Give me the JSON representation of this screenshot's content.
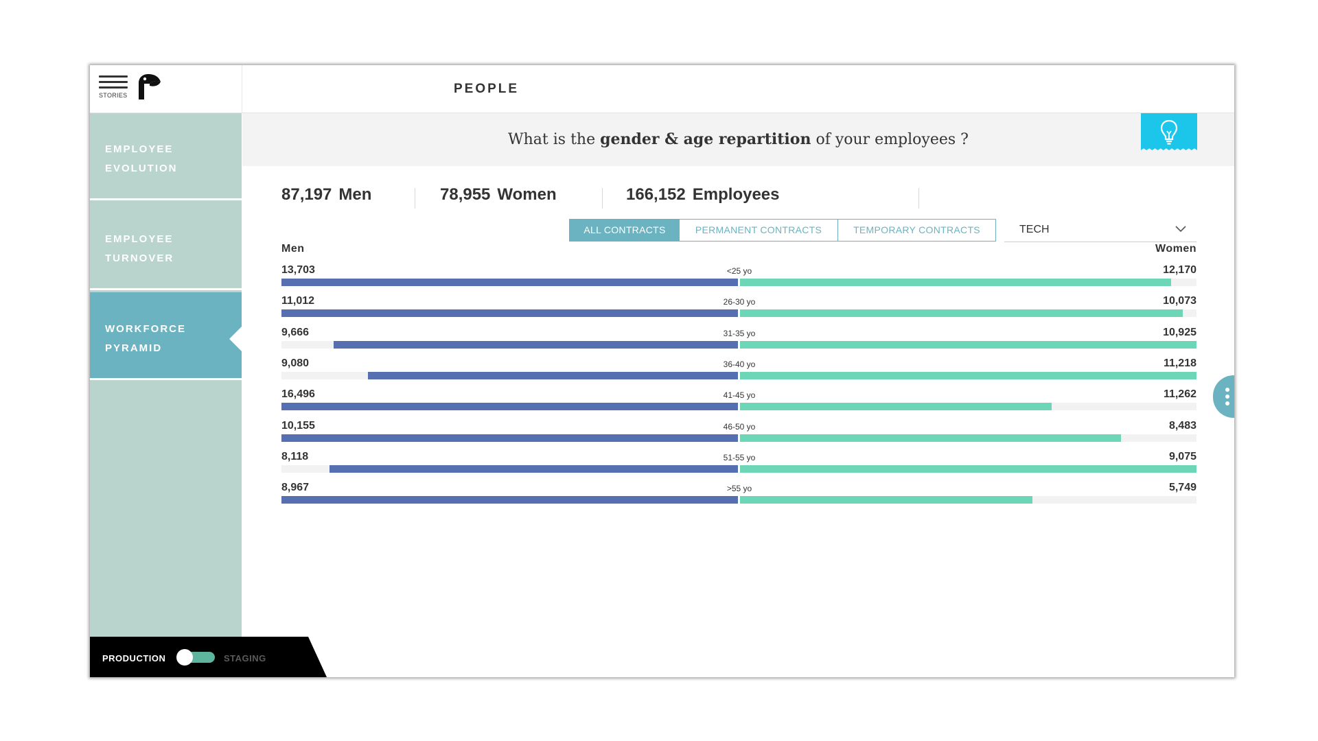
{
  "header": {
    "menu_label": "STORIES",
    "title": "PEOPLE"
  },
  "sidebar": {
    "items": [
      {
        "line1": "EMPLOYEE",
        "line2": "EVOLUTION",
        "active": false
      },
      {
        "line1": "EMPLOYEE",
        "line2": "TURNOVER",
        "active": false
      },
      {
        "line1": "WORKFORCE",
        "line2": "PYRAMID",
        "active": true
      }
    ]
  },
  "environment": {
    "production_label": "PRODUCTION",
    "staging_label": "STAGING",
    "current": "production"
  },
  "question": {
    "pre": "What is the ",
    "bold": "gender & age repartition",
    "post": " of your employees ?"
  },
  "stats": {
    "men": {
      "value": "87,197",
      "label": "Men"
    },
    "women": {
      "value": "78,955",
      "label": "Women"
    },
    "employees": {
      "value": "166,152",
      "label": "Employees"
    }
  },
  "filters": {
    "contracts": [
      {
        "label": "ALL CONTRACTS",
        "active": true
      },
      {
        "label": "PERMANENT CONTRACTS",
        "active": false
      },
      {
        "label": "TEMPORARY CONTRACTS",
        "active": false
      }
    ],
    "department": "TECH"
  },
  "colors": {
    "men": "#556fb0",
    "women": "#6dd6b7",
    "accent": "#6bb3c0",
    "sidebar": "#b8d4cd",
    "tip": "#1cc6ea"
  },
  "icons": {
    "menu": "hamburger-icon",
    "logo": "toucan-logo-icon",
    "tip": "lightbulb-icon",
    "dropdown": "chevron-down-icon",
    "more": "vertical-dots-icon"
  },
  "chart_data": {
    "type": "bar",
    "orientation": "horizontal-diverging",
    "left_label": "Men",
    "right_label": "Women",
    "categories": [
      "<25 yo",
      "26-30 yo",
      "31-35 yo",
      "36-40 yo",
      "41-45 yo",
      "46-50 yo",
      "51-55 yo",
      ">55 yo"
    ],
    "series": [
      {
        "name": "Men",
        "values": [
          13703,
          11012,
          9666,
          9080,
          16496,
          10155,
          8118,
          8967
        ],
        "labels": [
          "13,703",
          "11,012",
          "9,666",
          "9,080",
          "16,496",
          "10,155",
          "8,118",
          "8,967"
        ]
      },
      {
        "name": "Women",
        "values": [
          12170,
          10073,
          10925,
          11218,
          11262,
          8483,
          9075,
          5749
        ],
        "labels": [
          "12,170",
          "10,073",
          "10,925",
          "11,218",
          "11,262",
          "8,483",
          "9,075",
          "5,749"
        ]
      }
    ],
    "bar_fill_fraction": {
      "Men": [
        1.0,
        1.0,
        0.885,
        0.81,
        1.0,
        1.0,
        0.895,
        1.0
      ],
      "Women": [
        0.945,
        0.97,
        1.0,
        1.0,
        0.683,
        0.835,
        1.0,
        0.64
      ]
    }
  }
}
